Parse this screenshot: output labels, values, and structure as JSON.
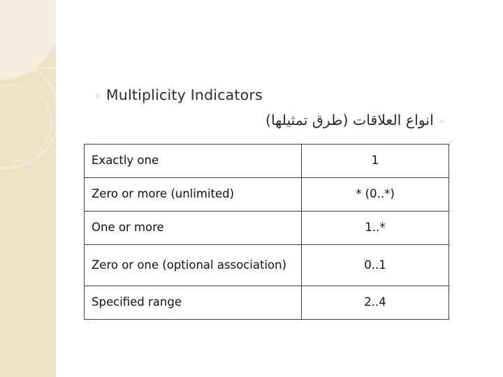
{
  "slide": {
    "bullets": [
      {
        "marker": "◦",
        "text": "Multiplicity Indicators"
      },
      {
        "marker": "◦",
        "text": "انواع العلاقات (طرق تمثيلها)"
      }
    ],
    "table": {
      "rows": [
        {
          "label": "Exactly one",
          "value": "1"
        },
        {
          "label": "Zero or more (unlimited)",
          "value": "* (0..*)"
        },
        {
          "label": "One or more",
          "value": "1..*"
        },
        {
          "label": "Zero or one (optional association)",
          "value": "0..1"
        },
        {
          "label": "Specified range",
          "value": "2..4"
        }
      ]
    },
    "colors": {
      "sidebar": "#ece2c6",
      "sidebar_accent": "#f4eedc",
      "text": "#2b2b2b",
      "table_border": "#3f3f3f"
    }
  }
}
